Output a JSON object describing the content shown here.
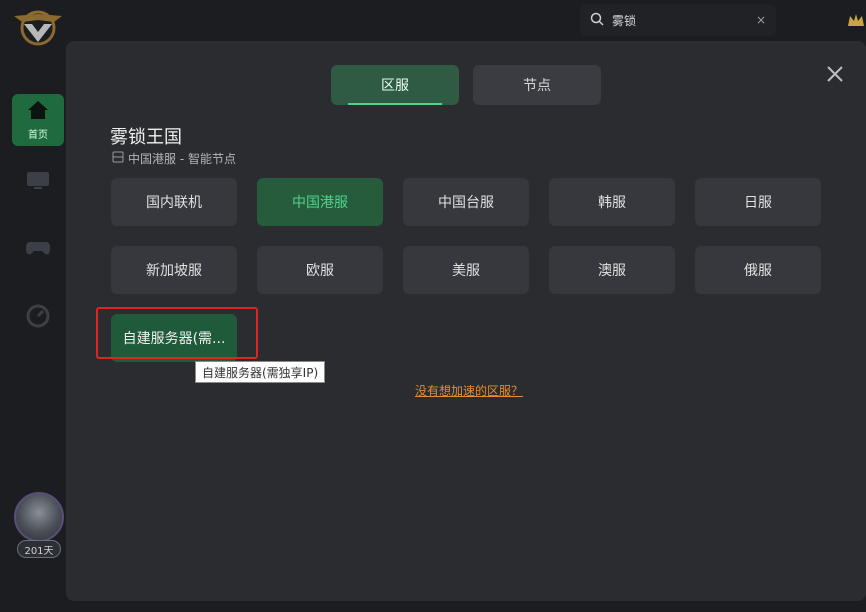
{
  "search": {
    "query": "雾锁",
    "clear_label": "×"
  },
  "sidebar": {
    "home_label": "首页",
    "days_badge": "201天"
  },
  "modal": {
    "tabs": [
      {
        "label": "区服",
        "active": true
      },
      {
        "label": "节点",
        "active": false
      }
    ],
    "game_title": "雾锁王国",
    "subtitle": "中国港服 - 智能节点",
    "regions": [
      {
        "label": "国内联机",
        "selected": false
      },
      {
        "label": "中国港服",
        "selected": true
      },
      {
        "label": "中国台服",
        "selected": false
      },
      {
        "label": "韩服",
        "selected": false
      },
      {
        "label": "日服",
        "selected": false
      },
      {
        "label": "新加坡服",
        "selected": false
      },
      {
        "label": "欧服",
        "selected": false
      },
      {
        "label": "美服",
        "selected": false
      },
      {
        "label": "澳服",
        "selected": false
      },
      {
        "label": "俄服",
        "selected": false
      }
    ],
    "custom_server_label": "自建服务器(需...",
    "tooltip": "自建服务器(需独享IP)",
    "missing_region_link": "没有想加速的区服？"
  },
  "colors": {
    "accent_green": "#4fd38a",
    "selected_bg": "#265c3c",
    "highlight_red": "#e02424",
    "link_orange": "#e88b2a"
  }
}
